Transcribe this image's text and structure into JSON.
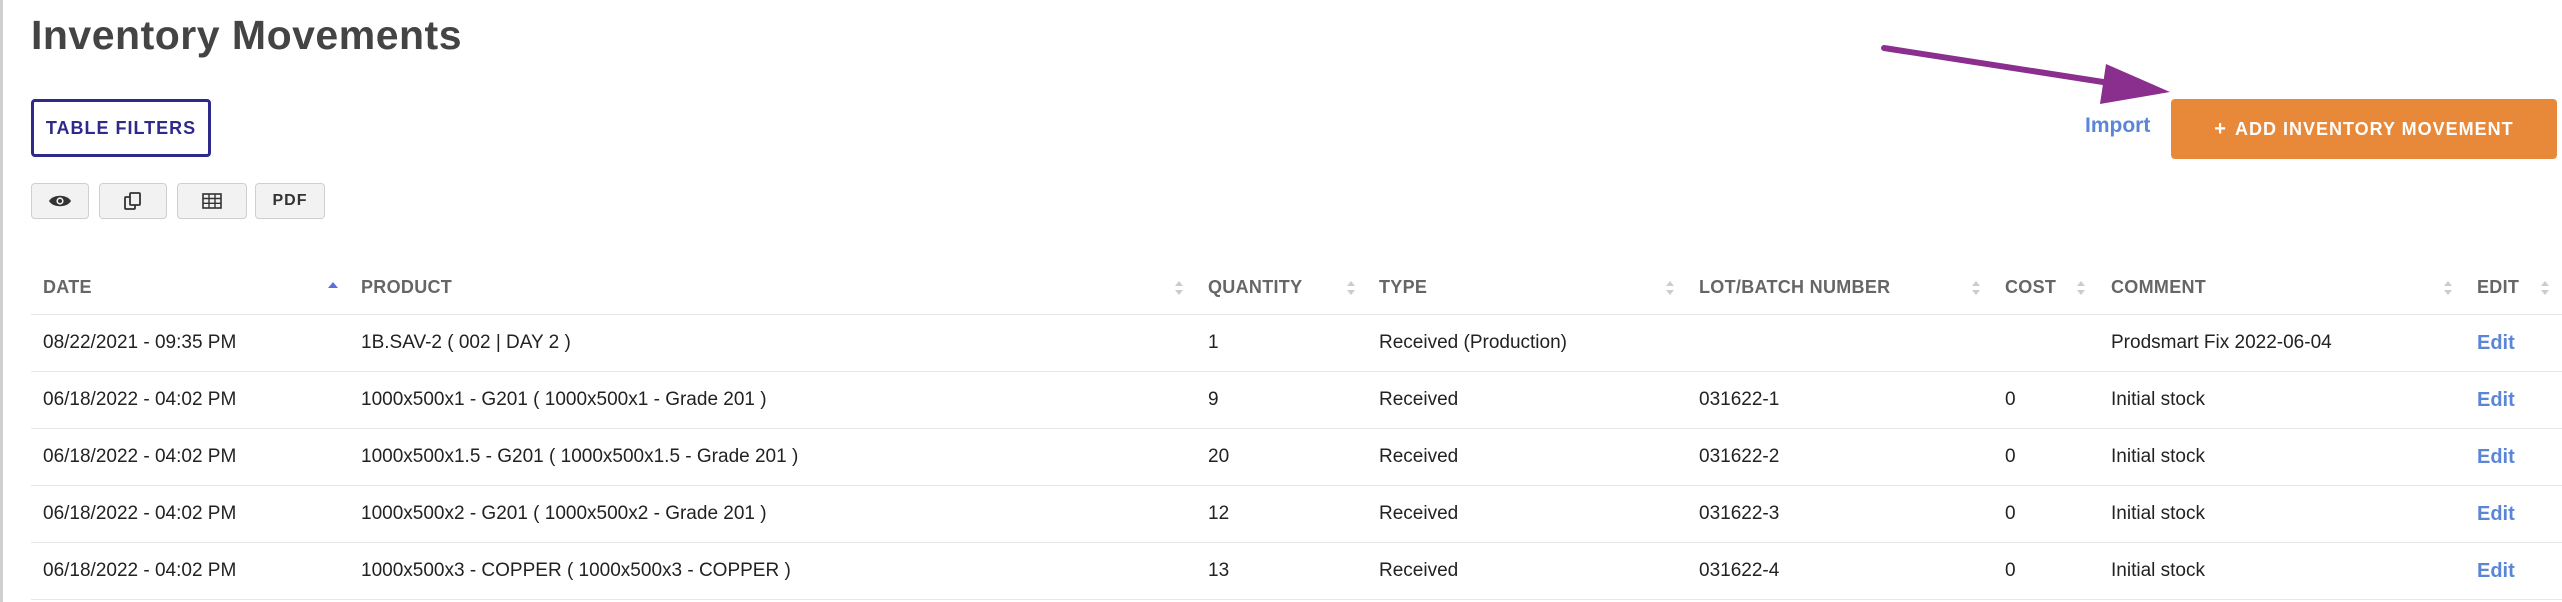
{
  "page": {
    "title": "Inventory Movements"
  },
  "toolbar": {
    "table_filters_label": "TABLE FILTERS",
    "buttons": [
      {
        "name": "eye-icon"
      },
      {
        "name": "copy-icon"
      },
      {
        "name": "table-icon"
      },
      {
        "name": "pdf",
        "label": "PDF"
      }
    ],
    "import_label": "Import",
    "add_label": "ADD INVENTORY MOVEMENT",
    "add_icon": "+"
  },
  "colors": {
    "accent_orange": "#e8893a",
    "link_blue": "#5b86d8",
    "filter_border": "#2e2a8c",
    "annotation_arrow": "#8b2f8f"
  },
  "table": {
    "headers": [
      "DATE",
      "PRODUCT",
      "QUANTITY",
      "TYPE",
      "LOT/BATCH NUMBER",
      "COST",
      "COMMENT",
      "EDIT"
    ],
    "sorted_column": "DATE",
    "rows": [
      {
        "date": "08/22/2021 - 09:35 PM",
        "product": "1B.SAV-2 ( 002 | DAY 2 )",
        "quantity": "1",
        "type": "Received (Production)",
        "lot": "",
        "cost": "",
        "comment": "Prodsmart Fix 2022-06-04",
        "edit": "Edit"
      },
      {
        "date": "06/18/2022 - 04:02 PM",
        "product": "1000x500x1 - G201 ( 1000x500x1 - Grade 201 )",
        "quantity": "9",
        "type": "Received",
        "lot": "031622-1",
        "cost": "0",
        "comment": "Initial stock",
        "edit": "Edit"
      },
      {
        "date": "06/18/2022 - 04:02 PM",
        "product": "1000x500x1.5 - G201 ( 1000x500x1.5 - Grade 201 )",
        "quantity": "20",
        "type": "Received",
        "lot": "031622-2",
        "cost": "0",
        "comment": "Initial stock",
        "edit": "Edit"
      },
      {
        "date": "06/18/2022 - 04:02 PM",
        "product": "1000x500x2 - G201 ( 1000x500x2 - Grade 201 )",
        "quantity": "12",
        "type": "Received",
        "lot": "031622-3",
        "cost": "0",
        "comment": "Initial stock",
        "edit": "Edit"
      },
      {
        "date": "06/18/2022 - 04:02 PM",
        "product": "1000x500x3 - COPPER ( 1000x500x3 - COPPER )",
        "quantity": "13",
        "type": "Received",
        "lot": "031622-4",
        "cost": "0",
        "comment": "Initial stock",
        "edit": "Edit"
      }
    ]
  }
}
